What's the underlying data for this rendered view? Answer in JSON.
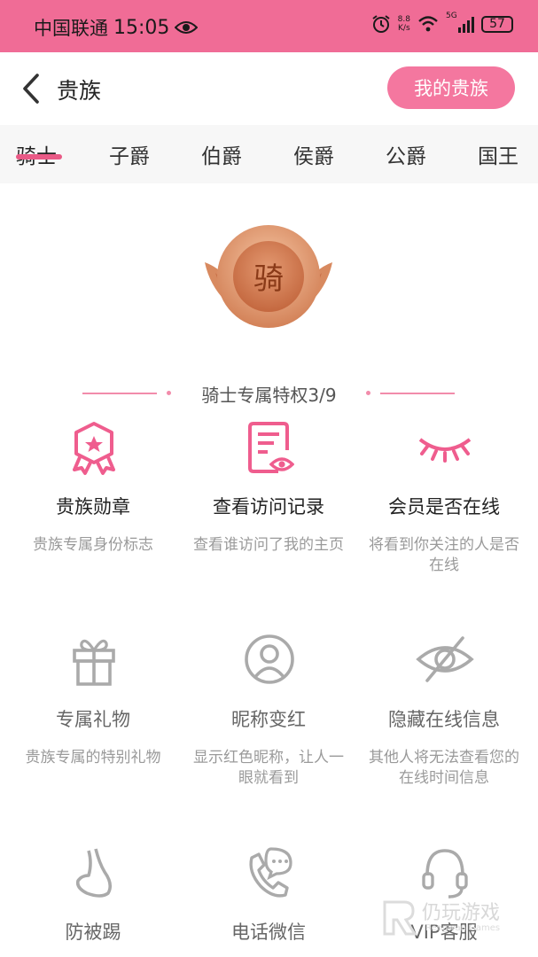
{
  "status_bar": {
    "carrier": "中国联通",
    "time": "15:05",
    "net_speed_value": "8.8",
    "net_speed_unit": "K/s",
    "signal_label": "5G",
    "battery": "57"
  },
  "header": {
    "title": "贵族",
    "my_noble_button": "我的贵族"
  },
  "tabs": [
    {
      "label": "骑士",
      "active": true
    },
    {
      "label": "子爵",
      "active": false
    },
    {
      "label": "伯爵",
      "active": false
    },
    {
      "label": "侯爵",
      "active": false
    },
    {
      "label": "公爵",
      "active": false
    },
    {
      "label": "国王",
      "active": false
    }
  ],
  "medal": {
    "char": "骑"
  },
  "section": {
    "title": "骑士专属特权3/9"
  },
  "features": [
    {
      "name": "贵族勋章",
      "desc": "贵族专属身份标志",
      "icon": "badge-icon",
      "unlocked": true
    },
    {
      "name": "查看访问记录",
      "desc": "查看谁访问了我的主页",
      "icon": "visit-record-icon",
      "unlocked": true
    },
    {
      "name": "会员是否在线",
      "desc": "将看到你关注的人是否在线",
      "icon": "eye-closed-icon",
      "unlocked": true
    },
    {
      "name": "专属礼物",
      "desc": "贵族专属的特别礼物",
      "icon": "gift-icon",
      "unlocked": false
    },
    {
      "name": "昵称变红",
      "desc": "显示红色昵称，让人一眼就看到",
      "icon": "user-icon",
      "unlocked": false
    },
    {
      "name": "隐藏在线信息",
      "desc": "其他人将无法查看您的在线时间信息",
      "icon": "eye-hidden-icon",
      "unlocked": false
    },
    {
      "name": "防被踢",
      "desc": "",
      "icon": "foot-icon",
      "unlocked": false
    },
    {
      "name": "电话微信",
      "desc": "",
      "icon": "phone-chat-icon",
      "unlocked": false
    },
    {
      "name": "VIP客服",
      "desc": "",
      "icon": "headset-icon",
      "unlocked": false
    }
  ],
  "watermark": {
    "cn": "仍玩游戏",
    "en": "Rengwan Games"
  },
  "colors": {
    "accent": "#f06c96",
    "button": "#f4779f",
    "icon_active": "#ef5d8e",
    "icon_locked": "#aaaaaa"
  }
}
